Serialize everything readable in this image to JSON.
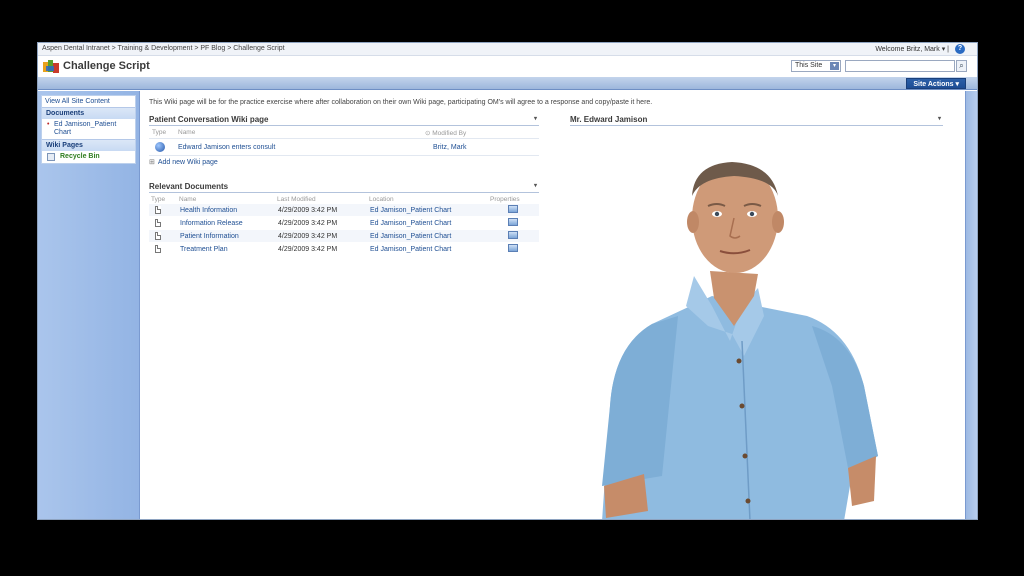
{
  "topbar": {
    "breadcrumb": "Aspen Dental Intranet > Training & Development > PF Blog > Challenge Script",
    "welcome": "Welcome Britz, Mark ▾  |",
    "help": "?"
  },
  "header": {
    "title": "Challenge Script",
    "scope": "This Site",
    "search_placeholder": "",
    "site_actions": "Site Actions ▾"
  },
  "leftnav": {
    "view_all": "View All Site Content",
    "documents_heading": "Documents",
    "documents_items": [
      "Ed Jamison_Patient Chart"
    ],
    "wiki_heading": "Wiki Pages",
    "recycle": "Recycle Bin"
  },
  "main": {
    "intro": "This Wiki page will be for the practice exercise where after collaboration on their own Wiki page, participating OM's will agree to a response and copy/paste it here.",
    "wiki_part": {
      "title": "Patient Conversation Wiki page",
      "headers": [
        "Type",
        "Name",
        "Modified By"
      ],
      "rows": [
        {
          "name": "Edward Jamison enters consult",
          "modified_by": "Britz, Mark"
        }
      ],
      "add_link": "Add new Wiki page"
    },
    "docs_part": {
      "title": "Relevant Documents",
      "headers": [
        "Type",
        "Name",
        "Last Modified",
        "Location",
        "Properties"
      ],
      "rows": [
        {
          "name": "Health Information",
          "modified": "4/29/2009 3:42 PM",
          "location": "Ed Jamison_Patient Chart"
        },
        {
          "name": "Information Release",
          "modified": "4/29/2009 3:42 PM",
          "location": "Ed Jamison_Patient Chart"
        },
        {
          "name": "Patient Information",
          "modified": "4/29/2009 3:42 PM",
          "location": "Ed Jamison_Patient Chart"
        },
        {
          "name": "Treatment Plan",
          "modified": "4/29/2009 3:42 PM",
          "location": "Ed Jamison_Patient Chart"
        }
      ]
    },
    "person_part": {
      "title": "Mr. Edward Jamison"
    }
  },
  "colors": {
    "link": "#1f4f93",
    "nav_bg": "#a4c0ea",
    "site_actions_bg": "#2357a2"
  }
}
